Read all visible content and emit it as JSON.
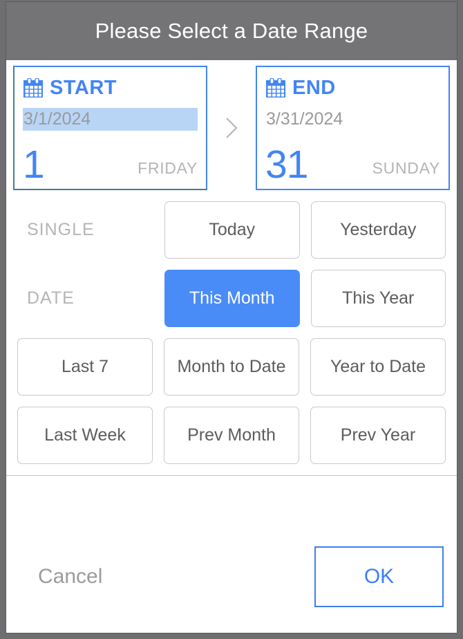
{
  "dialog": {
    "title": "Please Select a Date Range",
    "accent_color": "#4285f4",
    "header_bg": "#747476"
  },
  "range": {
    "separator_icon": "chevron-right-icon",
    "start": {
      "icon": "calendar-icon",
      "label": "START",
      "date_value": "3/1/2024",
      "day_number": "1",
      "weekday": "FRIDAY",
      "selected": true
    },
    "end": {
      "icon": "calendar-icon",
      "label": "END",
      "date_value": "3/31/2024",
      "day_number": "31",
      "weekday": "SUNDAY",
      "selected": false
    }
  },
  "presets": {
    "row_labels": [
      "SINGLE",
      "DATE"
    ],
    "rows": [
      {
        "label": "SINGLE",
        "buttons": [
          {
            "label": "Today",
            "active": false
          },
          {
            "label": "Yesterday",
            "active": false
          }
        ]
      },
      {
        "label": "DATE",
        "buttons": [
          {
            "label": "This Month",
            "active": true
          },
          {
            "label": "This Year",
            "active": false
          }
        ]
      },
      {
        "label": "",
        "buttons": [
          {
            "label": "Last 7",
            "active": false
          },
          {
            "label": "Month to Date",
            "active": false
          },
          {
            "label": "Year to Date",
            "active": false
          }
        ]
      },
      {
        "label": "",
        "buttons": [
          {
            "label": "Last Week",
            "active": false
          },
          {
            "label": "Prev Month",
            "active": false
          },
          {
            "label": "Prev Year",
            "active": false
          }
        ]
      }
    ]
  },
  "footer": {
    "cancel_label": "Cancel",
    "ok_label": "OK"
  }
}
